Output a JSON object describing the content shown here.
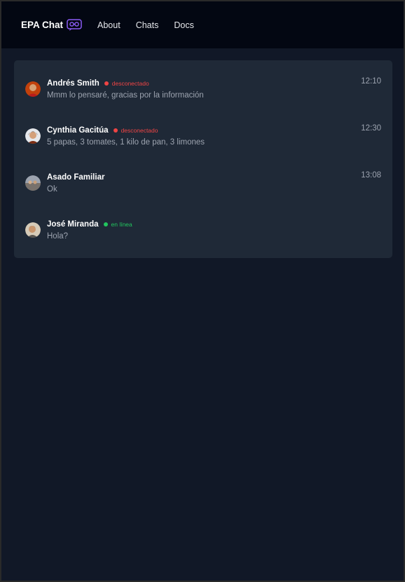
{
  "navbar": {
    "brand": "EPA Chat",
    "brand_icon": "glasses-chat-icon",
    "links": [
      "About",
      "Chats",
      "Docs"
    ]
  },
  "colors": {
    "offline": "#ef4444",
    "online": "#22c55e",
    "brand_accent": "#8b5cf6"
  },
  "chats": [
    {
      "name": "Andrés Smith",
      "status": "desconectado",
      "status_kind": "offline",
      "message": "Mmm lo pensaré, gracias por la información",
      "time": "12:10"
    },
    {
      "name": "Cynthia Gacitúa",
      "status": "desconectado",
      "status_kind": "offline",
      "message": "5 papas, 3 tomates, 1 kilo de pan, 3 limones",
      "time": "12:30"
    },
    {
      "name": "Asado Familiar",
      "status": "",
      "status_kind": "none",
      "message": "Ok",
      "time": "13:08"
    },
    {
      "name": "José Miranda",
      "status": "en línea",
      "status_kind": "online",
      "message": "Hola?",
      "time": ""
    }
  ]
}
